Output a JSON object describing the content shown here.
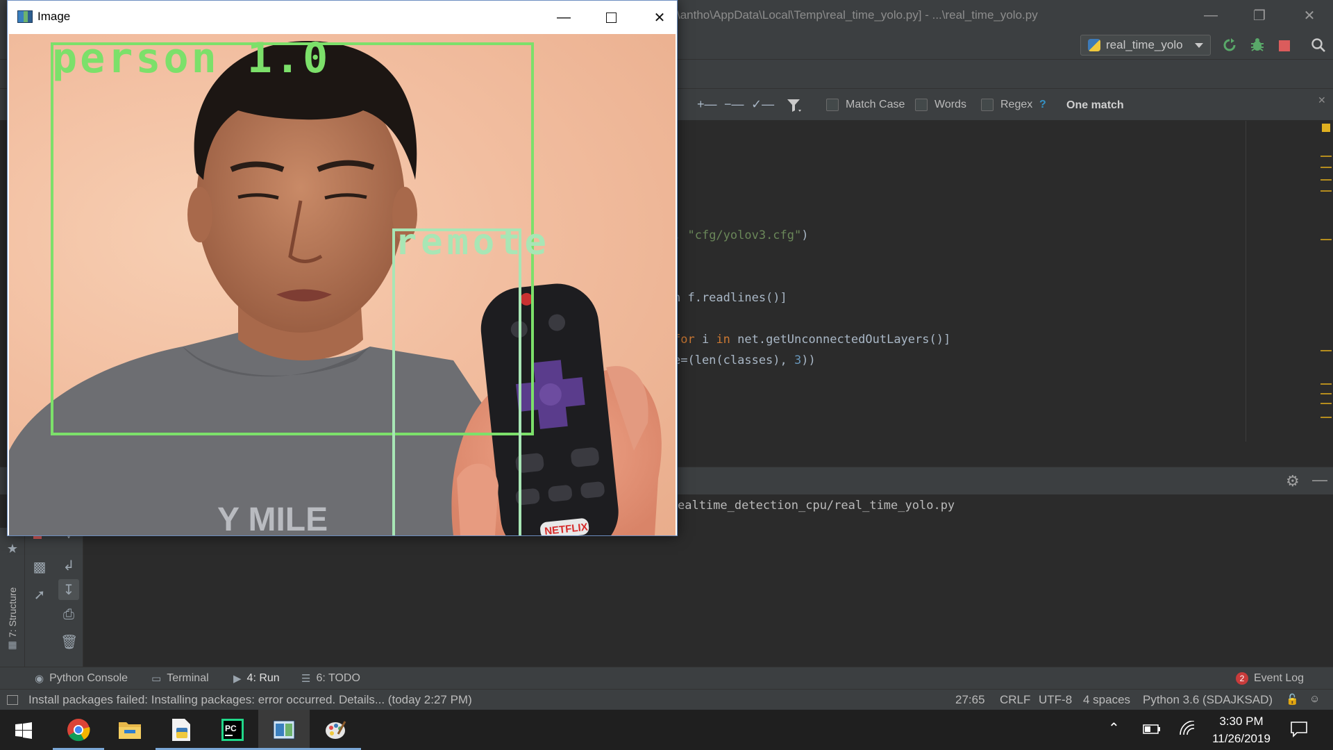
{
  "ide": {
    "title": "\\antho\\AppData\\Local\\Temp\\real_time_yolo.py] - ...\\real_time_yolo.py",
    "run_config": "real_time_yolo"
  },
  "findbar": {
    "match_case": "Match Case",
    "words": "Words",
    "regex": "Regex",
    "help": "?",
    "result": "One match"
  },
  "code": {
    "line1_str": "\"cfg/yolov3.cfg\"",
    "line2": "n f.readlines()]",
    "line3_kw1": "for",
    "line3_a": " i ",
    "line3_kw2": "in",
    "line3_b": " net.getUnconnectedOutLayers()]",
    "line4_a": "e=(len(classes), ",
    "line4_num": "3",
    "line4_b": "))"
  },
  "run": {
    "path": "ealtime_detection_cpu/real_time_yolo.py"
  },
  "sidebar": {
    "structure_label": "7: Structure"
  },
  "tool_tabs": {
    "python_console": "Python Console",
    "terminal": "Terminal",
    "run": "4: Run",
    "todo": "6: TODO",
    "event_log": "Event Log",
    "event_count": "2"
  },
  "status": {
    "message": "Install packages failed: Installing packages: error occurred. Details... (today 2:27 PM)",
    "position": "27:65",
    "line_sep": "CRLF",
    "encoding": "UTF-8",
    "indent": "4 spaces",
    "interpreter": "Python 3.6 (SDAJKSAD)"
  },
  "image_window": {
    "title": "Image",
    "person_label": "person 1.0",
    "remote_label": "remote",
    "remote_brand": "NETFLIX",
    "shirt_text": "Y MILE"
  },
  "taskbar": {
    "time": "3:30 PM",
    "date": "11/26/2019"
  },
  "colors": {
    "person_box": "#7ce06a",
    "remote_box": "#a8e6b5",
    "ide_bg": "#2b2b2b"
  }
}
